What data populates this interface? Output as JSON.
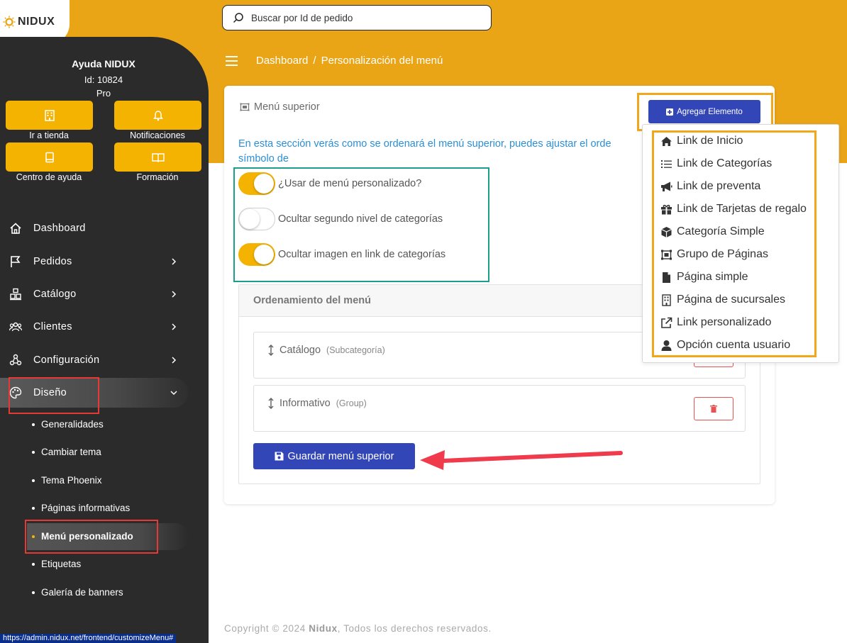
{
  "brand": {
    "logo_text": "NIDUX"
  },
  "search": {
    "placeholder": "Buscar por Id de pedido"
  },
  "breadcrumb": {
    "items": [
      "Dashboard",
      "/",
      "Personalización del menú"
    ]
  },
  "user": {
    "name": "Ayuda NIDUX",
    "id": "Id: 10824",
    "plan": "Pro"
  },
  "quick_actions": [
    {
      "label": "Ir a tienda",
      "icon": "store-icon"
    },
    {
      "label": "Notificaciones",
      "icon": "bell-icon"
    },
    {
      "label": "Centro de ayuda",
      "icon": "book-icon"
    },
    {
      "label": "Formación",
      "icon": "open-book-icon"
    }
  ],
  "nav": [
    {
      "label": "Dashboard",
      "icon": "home-icon"
    },
    {
      "label": "Pedidos",
      "icon": "flag-icon"
    },
    {
      "label": "Catálogo",
      "icon": "boxes-icon"
    },
    {
      "label": "Clientes",
      "icon": "users-icon"
    },
    {
      "label": "Configuración",
      "icon": "nodes-icon"
    },
    {
      "label": "Diseño",
      "icon": "palette-icon"
    }
  ],
  "subnav": [
    {
      "label": "Generalidades"
    },
    {
      "label": "Cambiar tema"
    },
    {
      "label": "Tema Phoenix"
    },
    {
      "label": "Páginas informativas"
    },
    {
      "label": "Menú personalizado"
    },
    {
      "label": "Etiquetas"
    },
    {
      "label": "Galería de banners"
    }
  ],
  "status_url": "https://admin.nidux.net/frontend/customizeMenu#",
  "card": {
    "title": "Menú superior",
    "add_button": "Agregar Elemento",
    "info": "En esta sección verás como se ordenará el menú superior, puedes ajustar el orde",
    "info_line2": "símbolo de",
    "toggles": [
      {
        "label": "¿Usar de menú personalizado?",
        "state": "on"
      },
      {
        "label": "Ocultar segundo nivel de categorías",
        "state": "off"
      },
      {
        "label": "Ocultar imagen en link de categorías",
        "state": "on"
      }
    ],
    "order_title": "Ordenamiento del menú",
    "order_items": [
      {
        "name": "Catálogo",
        "type": "(Subcategoría)"
      },
      {
        "name": "Informativo",
        "type": "(Group)"
      }
    ],
    "save_button": "Guardar menú superior"
  },
  "dropdown": [
    {
      "label": "Link de Inicio",
      "icon": "home-icon"
    },
    {
      "label": "Link de Categorías",
      "icon": "list-icon"
    },
    {
      "label": "Link de preventa",
      "icon": "megaphone-icon"
    },
    {
      "label": "Link de Tarjetas de regalo",
      "icon": "gift-icon"
    },
    {
      "label": "Categoría Simple",
      "icon": "cube-icon"
    },
    {
      "label": "Grupo de Páginas",
      "icon": "object-group-icon"
    },
    {
      "label": "Página simple",
      "icon": "file-icon"
    },
    {
      "label": "Página de sucursales",
      "icon": "building-icon"
    },
    {
      "label": "Link personalizado",
      "icon": "external-link-icon"
    },
    {
      "label": "Opción cuenta usuario",
      "icon": "user-icon"
    }
  ],
  "footer": {
    "prefix": "Copyright © 2024",
    "brand": "Nidux",
    "suffix": ", Todos los derechos reservados."
  },
  "colors": {
    "primary": "#3346b8",
    "accent": "#f5b301",
    "sidebar": "#2b2b2b",
    "topband": "#e9a516",
    "info": "#2a8fd6"
  }
}
